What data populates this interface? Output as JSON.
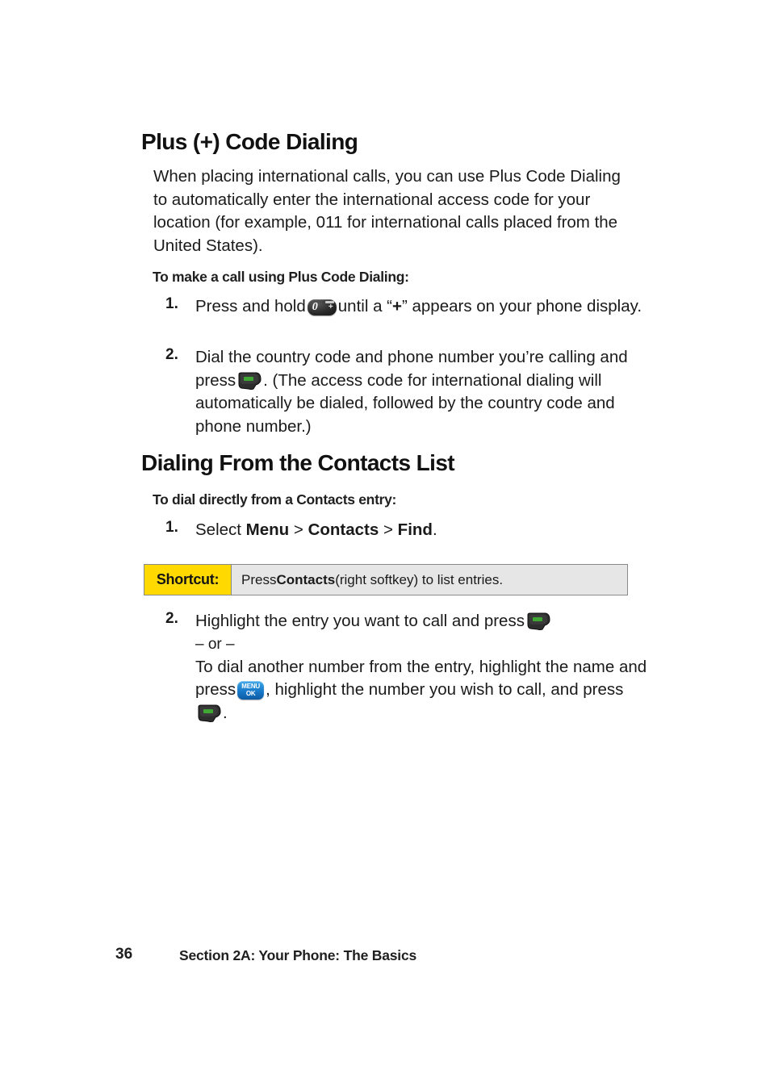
{
  "page": {
    "background_color": "#ffffff",
    "text_color": "#1a1a1a"
  },
  "sections": [
    {
      "heading": "Plus (+) Code Dialing",
      "paragraph": "When placing international calls, you can use Plus Code Dialing to automatically enter the international access code for your location (for example, 011 for international calls placed from the United States).",
      "subheading": "To make a call using Plus Code Dialing:",
      "steps": [
        {
          "number": "1.",
          "text_before": "Press and hold",
          "icon": "zero-plus-key-icon",
          "text_after_quote_open": "until a “",
          "bold_symbol": "+",
          "text_after": "” appears on your phone display."
        },
        {
          "number": "2.",
          "text_before": "Dial the country code and phone number you’re calling and press",
          "icon": "talk-key-icon",
          "text_after": ". (The access code for international dialing will automatically be dialed, followed by the country code and phone number.)"
        }
      ]
    },
    {
      "heading": "Dialing From the Contacts List",
      "subheading": "To dial directly from a Contacts entry:",
      "steps": [
        {
          "number": "1.",
          "prefix": "Select ",
          "menu_label": "Menu",
          "sep1": " > ",
          "contacts_label": "Contacts",
          "sep2": " > ",
          "find_label": "Find",
          "suffix": "."
        },
        {
          "number": "2.",
          "line1_before": "Highlight the entry you want to call and press",
          "line1_icon": "talk-key-icon",
          "or_separator": "– or –",
          "line2_before": "To dial another number from the entry, highlight the name and press",
          "line2_icon": "menu-ok-key-icon",
          "line2_middle": ", highlight the number you wish to call, and press",
          "line2_icon2": "talk-key-icon",
          "line2_after": "."
        }
      ]
    }
  ],
  "shortcut": {
    "label": "Shortcut:",
    "text_before": "Press ",
    "bold_term": "Contacts",
    "text_after": " (right softkey) to list entries.",
    "label_background": "#ffd900",
    "body_background": "#e6e6e6",
    "border_color": "#8a8a8a"
  },
  "icons": {
    "zero_key": {
      "digit": "0",
      "plus": "+"
    },
    "menu_key": {
      "line1": "MENU",
      "line2": "OK",
      "color": "#1879c9"
    },
    "talk_key": {
      "label": "TALK",
      "color": "#2f2f2f",
      "accent": "#3ea832"
    }
  },
  "footer": {
    "page_number": "36",
    "section_title": "Section 2A: Your Phone: The Basics"
  }
}
